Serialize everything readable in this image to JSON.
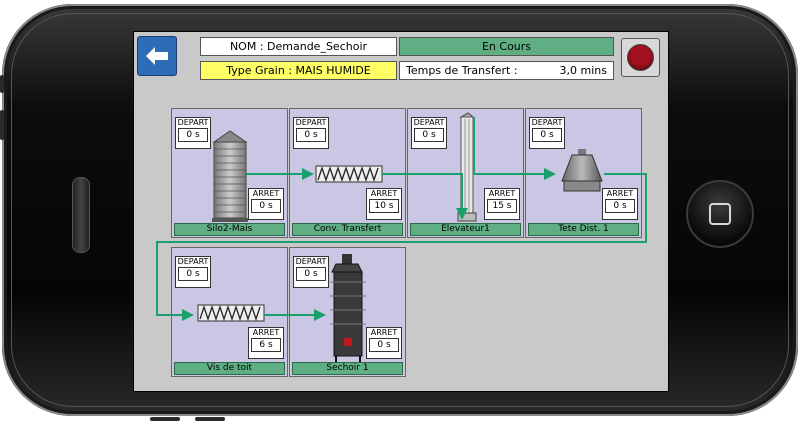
{
  "header": {
    "nom_label": "NOM : Demande_Sechoir",
    "type_label": "Type Grain : MAIS HUMIDE",
    "status": "En Cours",
    "temps_label": "Temps de Transfert :",
    "temps_value": "3,0 mins"
  },
  "controls": {
    "back_icon": "arrow-left-icon",
    "stop_icon": "stop-icon"
  },
  "labels": {
    "depart": "DEPART",
    "arret": "ARRET"
  },
  "colors": {
    "status_green": "#5fae84",
    "flow_line": "#1aa06a",
    "stop_red": "#a31020",
    "type_yellow": "#ffff66",
    "cell_bg": "#c9c7e3"
  },
  "equipment": [
    {
      "name": "Silo2-Mais",
      "depart": "0 s",
      "arret": "0 s",
      "icon": "silo-icon"
    },
    {
      "name": "Conv. Transfert",
      "depart": "0 s",
      "arret": "10 s",
      "icon": "conveyor-icon"
    },
    {
      "name": "Elevateur1",
      "depart": "0 s",
      "arret": "15 s",
      "icon": "elevator-icon"
    },
    {
      "name": "Tete Dist. 1",
      "depart": "0 s",
      "arret": "0 s",
      "icon": "distributor-head-icon"
    },
    {
      "name": "Vis de toit",
      "depart": "0 s",
      "arret": "6 s",
      "icon": "screw-conveyor-icon"
    },
    {
      "name": "Sechoir 1",
      "depart": "0 s",
      "arret": "0 s",
      "icon": "dryer-icon"
    }
  ]
}
